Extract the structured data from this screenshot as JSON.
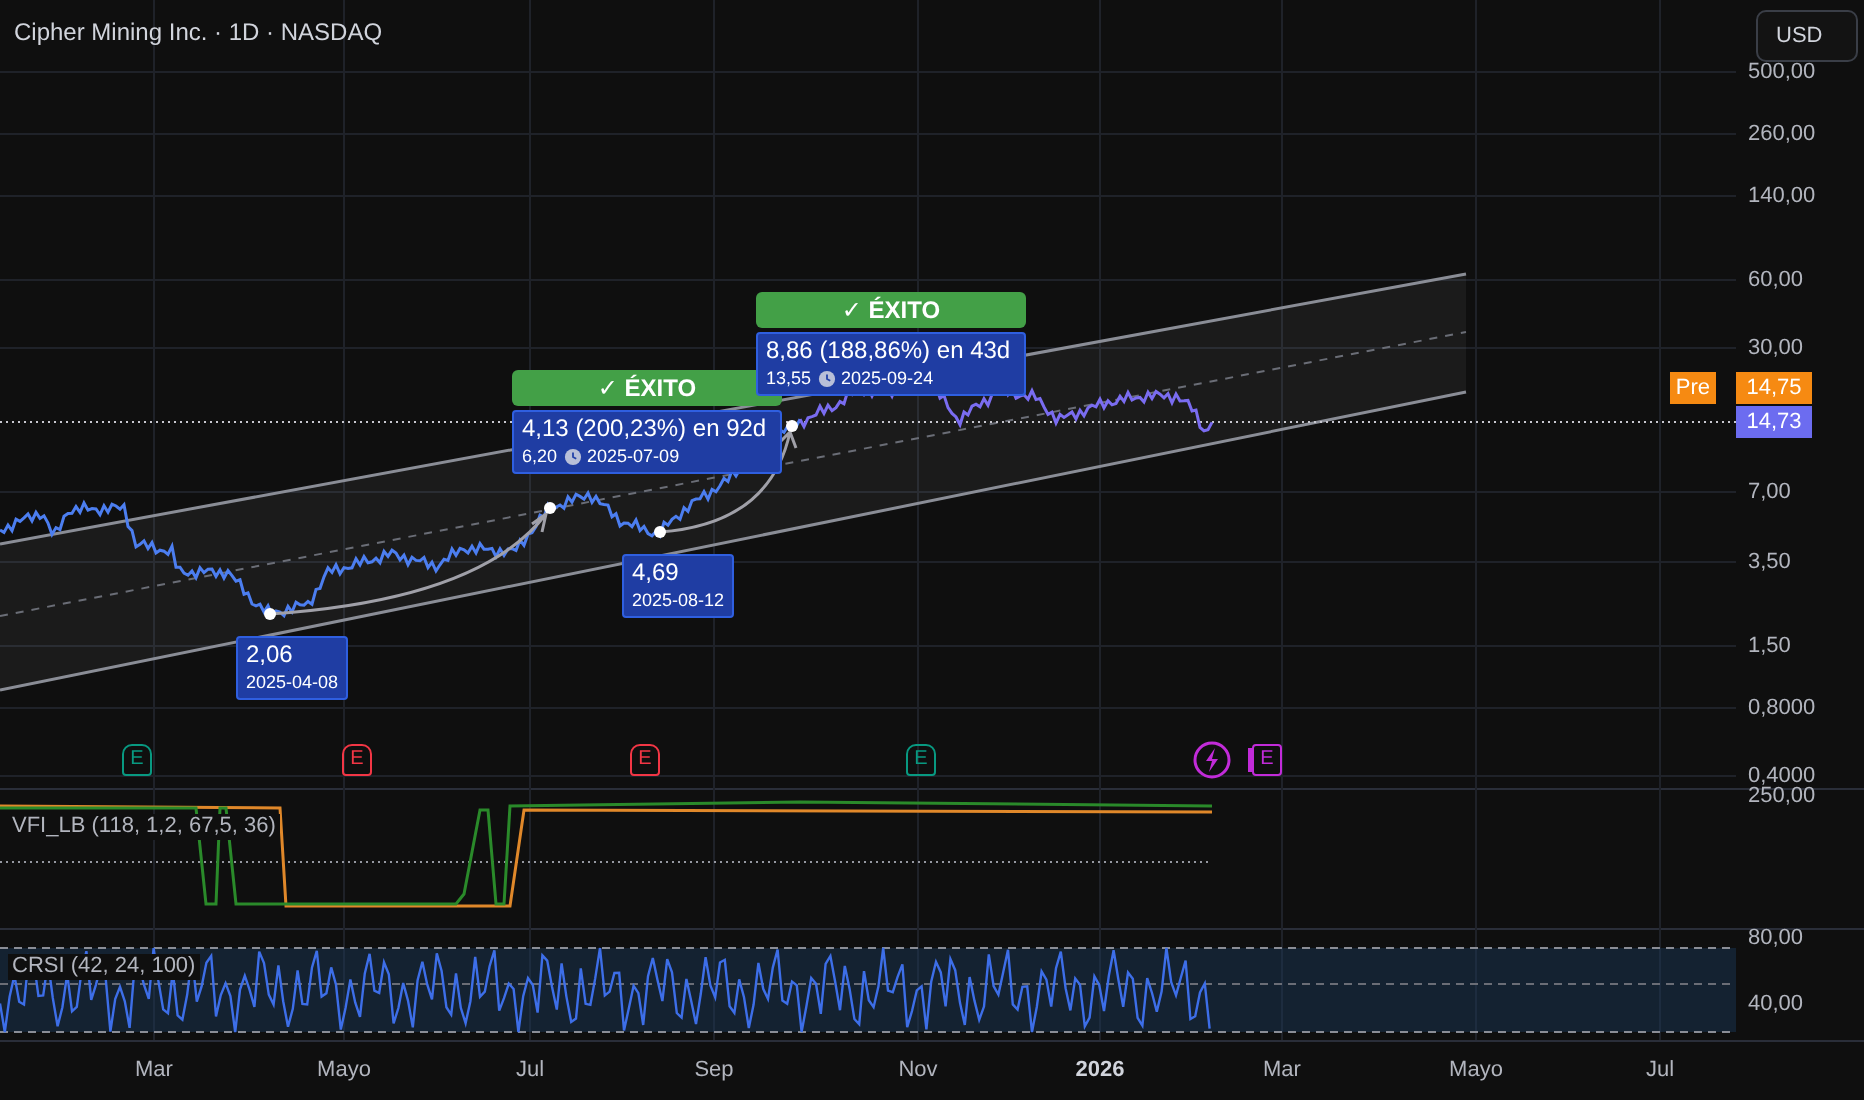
{
  "header": {
    "title": "Cipher Mining Inc. · 1D · NASDAQ",
    "currency_button": "USD"
  },
  "price_axis": {
    "labels": [
      "500,00",
      "260,00",
      "140,00",
      "60,00",
      "30,00",
      "7,00",
      "3,50",
      "1,50",
      "0,8000",
      "0,4000"
    ]
  },
  "price_tags": [
    {
      "kind": "premarket",
      "label": "Pre",
      "value": "14,75"
    },
    {
      "kind": "last",
      "value": "14,73"
    }
  ],
  "lows": [
    {
      "price": "2,06",
      "date": "2025-04-08"
    },
    {
      "price": "4,69",
      "date": "2025-08-12"
    }
  ],
  "targets": [
    {
      "status": "✓ ÉXITO",
      "gain": "4,13 (200,23%) en 92d",
      "price": "6,20",
      "date": "2025-07-09"
    },
    {
      "status": "✓ ÉXITO",
      "gain": "8,86 (188,86%) en 43d",
      "price": "13,55",
      "date": "2025-09-24"
    }
  ],
  "events": [
    {
      "kind": "earnings",
      "letter": "E",
      "color": "#089981"
    },
    {
      "kind": "earnings",
      "letter": "E",
      "color": "#f23645"
    },
    {
      "kind": "earnings",
      "letter": "E",
      "color": "#f23645"
    },
    {
      "kind": "earnings",
      "letter": "E",
      "color": "#089981"
    },
    {
      "kind": "bolt",
      "color": "#c22bd9"
    },
    {
      "kind": "upcoming",
      "letter": "E",
      "color": "#c22bd9"
    }
  ],
  "indicators": [
    {
      "kind": "vfi",
      "label": "VFI_LB (118, 1,2, 67,5, 36)",
      "axis_labels": [
        "250,00"
      ]
    },
    {
      "kind": "crsi",
      "label": "CRSI (42, 24, 100)",
      "axis_labels": [
        "80,00",
        "40,00"
      ]
    }
  ],
  "time_axis": [
    {
      "label": "Mar",
      "emphasis": false
    },
    {
      "label": "Mayo",
      "emphasis": false
    },
    {
      "label": "Jul",
      "emphasis": false
    },
    {
      "label": "Sep",
      "emphasis": false
    },
    {
      "label": "Nov",
      "emphasis": false
    },
    {
      "label": "2026",
      "emphasis": true
    },
    {
      "label": "Mar",
      "emphasis": false
    },
    {
      "label": "Mayo",
      "emphasis": false
    },
    {
      "label": "Jul",
      "emphasis": false
    }
  ]
}
